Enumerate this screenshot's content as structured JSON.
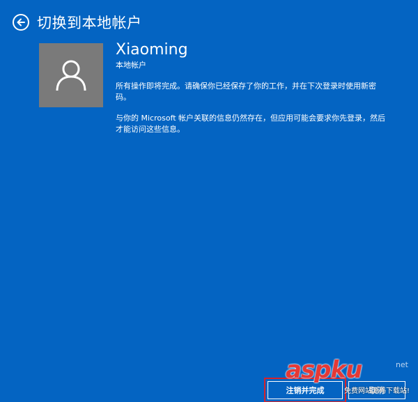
{
  "header": {
    "title": "切换到本地帐户",
    "back_icon": "back-arrow-icon"
  },
  "user": {
    "name": "Xiaoming",
    "account_type": "本地帐户",
    "avatar_icon": "user-avatar-icon"
  },
  "messages": {
    "para1": "所有操作即将完成。请确保你已经保存了你的工作，并在下次登录时使用新密码。",
    "para2": "与你的 Microsoft 帐户关联的信息仍然存在，但应用可能会要求你先登录，然后才能访问这些信息。"
  },
  "buttons": {
    "primary_label": "注销并完成",
    "secondary_label": "取消"
  },
  "watermark": {
    "main": "aspku",
    "suffix": "net",
    "tagline": "免费网站源码下载站!"
  },
  "colors": {
    "background": "#0464c2",
    "avatar_bg": "#7a7a7a",
    "highlight": "#d8222a"
  }
}
